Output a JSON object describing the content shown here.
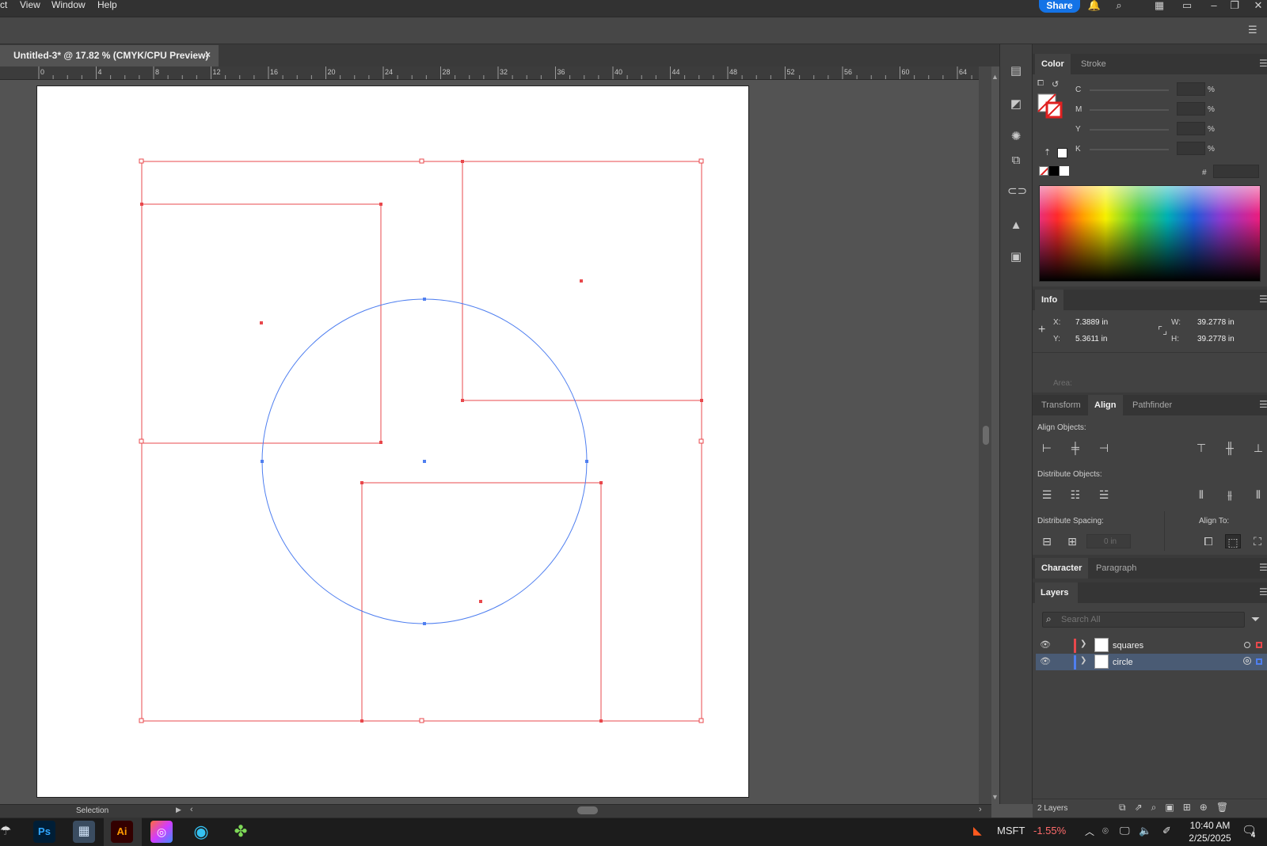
{
  "menu": {
    "items": [
      "ct",
      "View",
      "Window",
      "Help"
    ],
    "share_label": "Share"
  },
  "document": {
    "tab_title": "Untitled-3* @ 17.82 % (CMYK/CPU Preview)",
    "close_label": "×"
  },
  "ruler": {
    "labels": [
      "0",
      "4",
      "8",
      "12",
      "16",
      "20",
      "24",
      "28",
      "32",
      "36",
      "40",
      "44",
      "48",
      "52",
      "56",
      "60",
      "64"
    ]
  },
  "status": {
    "tool_label": "Selection"
  },
  "color_panel": {
    "tabs": [
      "Color",
      "Stroke"
    ],
    "channels": [
      {
        "label": "C",
        "unit": "%"
      },
      {
        "label": "M",
        "unit": "%"
      },
      {
        "label": "Y",
        "unit": "%"
      },
      {
        "label": "K",
        "unit": "%"
      }
    ],
    "hex_label": "#"
  },
  "info_panel": {
    "tab": "Info",
    "x_label": "X:",
    "x_value": "7.3889 in",
    "y_label": "Y:",
    "y_value": "5.3611 in",
    "w_label": "W:",
    "w_value": "39.2778 in",
    "h_label": "H:",
    "h_value": "39.2778 in",
    "area_label": "Area:"
  },
  "align_panel": {
    "tabs": [
      "Transform",
      "Align",
      "Pathfinder"
    ],
    "align_objects_label": "Align Objects:",
    "distribute_objects_label": "Distribute Objects:",
    "distribute_spacing_label": "Distribute Spacing:",
    "align_to_label": "Align To:",
    "spacing_value": "0 in"
  },
  "character_panel": {
    "tabs": [
      "Character",
      "Paragraph"
    ]
  },
  "layers_panel": {
    "tab": "Layers",
    "search_placeholder": "Search All",
    "layers": [
      {
        "name": "squares",
        "color": "#e8484c"
      },
      {
        "name": "circle",
        "color": "#4f7ff0"
      }
    ],
    "count_label": "2 Layers"
  },
  "taskbar": {
    "apps": [
      "Ps",
      "Ai"
    ],
    "ticker_symbol": "MSFT",
    "ticker_change": "-1.55%",
    "time": "10:40 AM",
    "date": "2/25/2025",
    "notification_count": "4"
  },
  "colors": {
    "accent": "#1473e6",
    "selection_red": "#e8484c",
    "selection_blue": "#4f7ff0"
  }
}
